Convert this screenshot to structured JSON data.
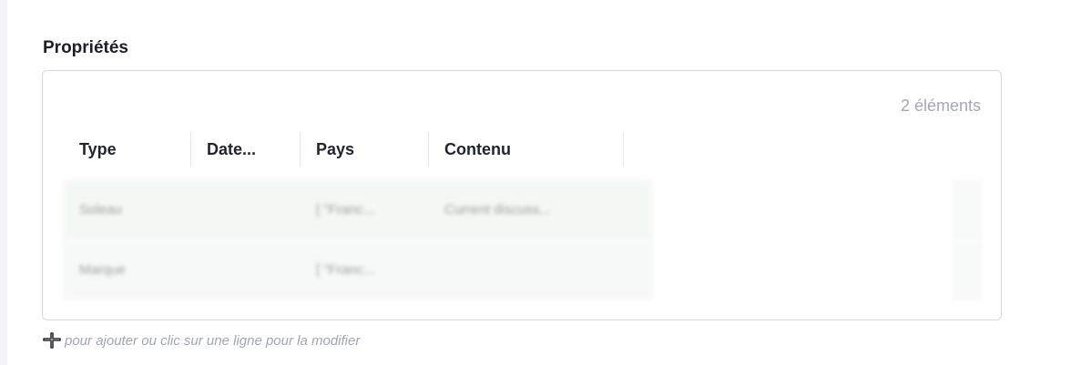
{
  "section": {
    "title": "Propriétés"
  },
  "table": {
    "count_label": "2 éléments",
    "columns": [
      "Type",
      "Date...",
      "Pays",
      "Contenu"
    ],
    "rows": [
      {
        "type": "Soleau",
        "date": "",
        "pays": "[ \"Franc...",
        "contenu": "Current discuss..."
      },
      {
        "type": "Marque",
        "date": "",
        "pays": "[ \"Franc...",
        "contenu": ""
      }
    ]
  },
  "hint": {
    "icon": "plus-cross-icon",
    "text": "pour ajouter ou clic sur une ligne pour la modifier"
  }
}
